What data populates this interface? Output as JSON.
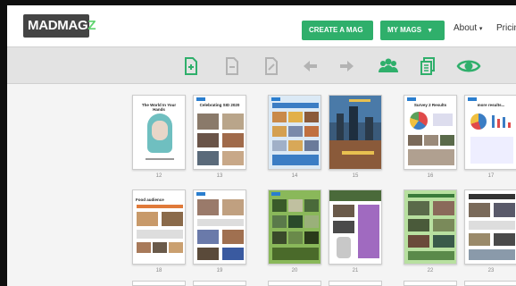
{
  "brand": {
    "logo_main": "MADMAG",
    "logo_accent": "Z"
  },
  "nav": {
    "create_label": "CREATE A MAG",
    "mymags_label": "MY MAGS",
    "about_label": "About",
    "pricing_label": "Pricin"
  },
  "toolbar": {
    "icons": [
      "add-page-icon",
      "add-page-outline-icon",
      "edit-page-icon",
      "arrow-left-icon",
      "arrow-right-icon",
      "group-icon",
      "copy-icon",
      "eye-icon"
    ],
    "colors": {
      "active": "#2faf6b",
      "inactive": "#b3b3b3"
    }
  },
  "pages": {
    "row1": [
      {
        "num": "12",
        "title": "The World In Your Hands"
      },
      {
        "num": "13",
        "title": "Celebrating SID 2020"
      },
      {
        "num": "14",
        "title": ""
      },
      {
        "num": "15",
        "title": ""
      },
      {
        "num": "16",
        "title": "Survey 2 Results"
      },
      {
        "num": "17",
        "title": "more results..."
      }
    ],
    "row2": [
      {
        "num": "18",
        "title": "Food audience"
      },
      {
        "num": "19",
        "title": ""
      },
      {
        "num": "20",
        "title": ""
      },
      {
        "num": "21",
        "title": ""
      },
      {
        "num": "22",
        "title": ""
      },
      {
        "num": "23",
        "title": ""
      }
    ]
  }
}
